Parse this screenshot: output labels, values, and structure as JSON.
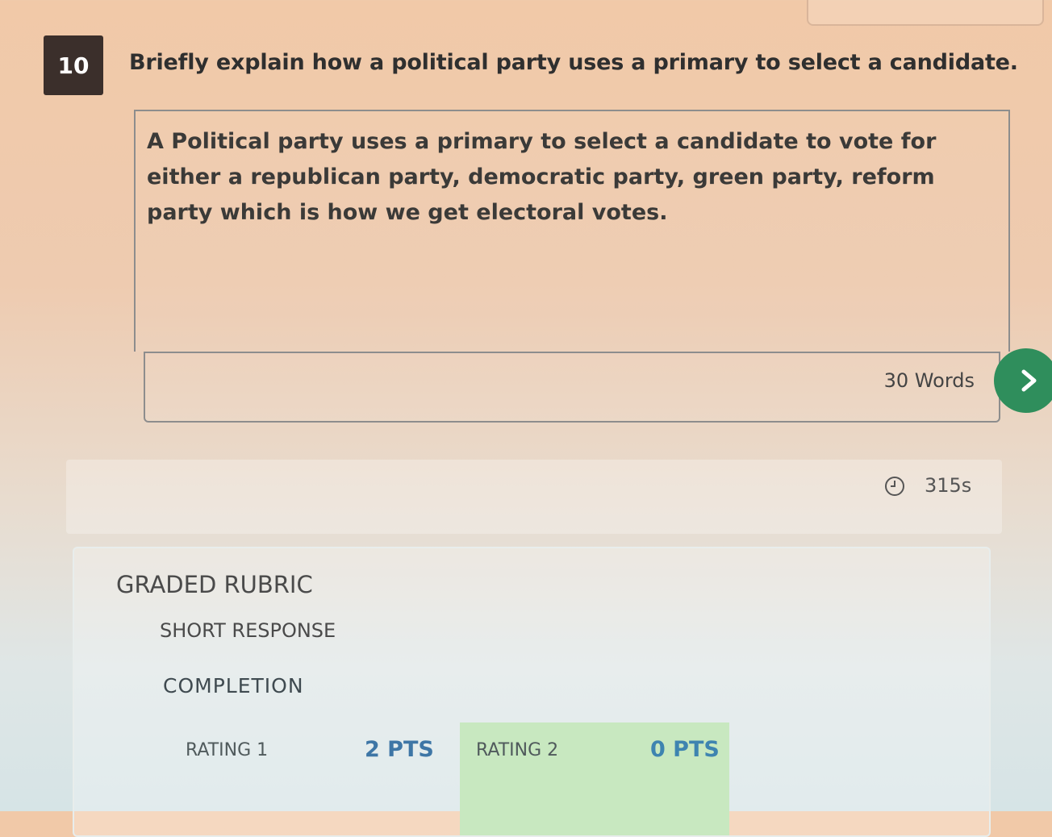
{
  "question": {
    "number": "10",
    "prompt": "Briefly explain how a political party uses a primary to select a candidate."
  },
  "answer": {
    "text": "A Political party uses a primary to select a candidate to vote for either a republican party, democratic party, green party, reform party which is how we get electoral votes.",
    "word_count_label": "30 Words"
  },
  "timer": {
    "value": "315s"
  },
  "rubric": {
    "title": "GRADED RUBRIC",
    "type": "SHORT RESPONSE",
    "criterion": "COMPLETION",
    "ratings": [
      {
        "label": "RATING 1",
        "points": "2 PTS"
      },
      {
        "label": "RATING 2",
        "points": "0 PTS"
      }
    ]
  },
  "colors": {
    "next_button": "#2f8e5c",
    "selected_rating": "#c8e8c0",
    "points_text": "#3e76a6",
    "question_badge": "#3b2f2b"
  },
  "icons": {
    "next": "chevron-right-icon",
    "timer": "clock-icon"
  }
}
